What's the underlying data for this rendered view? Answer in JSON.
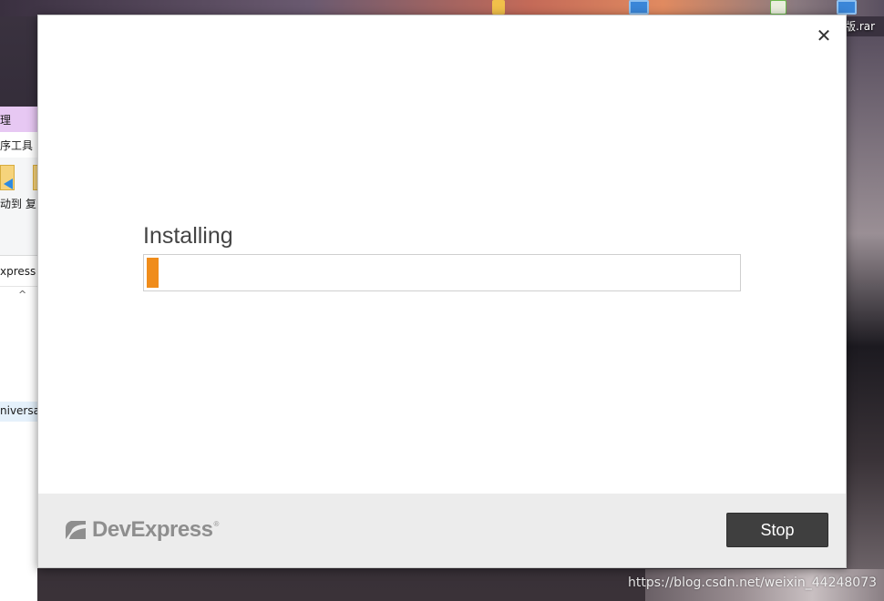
{
  "desktop": {
    "file_label": "版.rar",
    "watermark": "https://blog.csdn.net/weixin_44248073"
  },
  "explorer": {
    "title_fragment": "理",
    "ribbon_tab_fragment": "序工具",
    "ribbon_buttons_fragment": "动到  复",
    "address_fragment": "xpress U",
    "selected_item_fragment": "niversal"
  },
  "dialog": {
    "close_icon": "close-icon",
    "status_text": "Installing",
    "progress": 0.02,
    "progress_color": "#f08c1a",
    "footer": {
      "brand": "DevExpress",
      "brand_mark": "®",
      "stop_label": "Stop"
    }
  }
}
